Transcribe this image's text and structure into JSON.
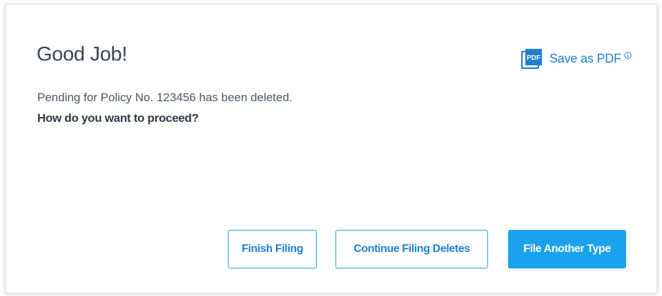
{
  "dialog": {
    "title": "Good Job!",
    "message": "Pending for Policy No. 123456 has been deleted.",
    "question": "How do you want to proceed?"
  },
  "save_pdf": {
    "icon_text": "PDF",
    "label": "Save as PDF",
    "icon": "pdf-icon",
    "info_icon": "info-icon"
  },
  "actions": {
    "finish_label": "Finish Filing",
    "continue_label": "Continue Filing Deletes",
    "another_label": "File Another Type"
  },
  "colors": {
    "accent": "#1aa3ec",
    "link": "#1f7fd0",
    "title_text": "#3a4550"
  }
}
